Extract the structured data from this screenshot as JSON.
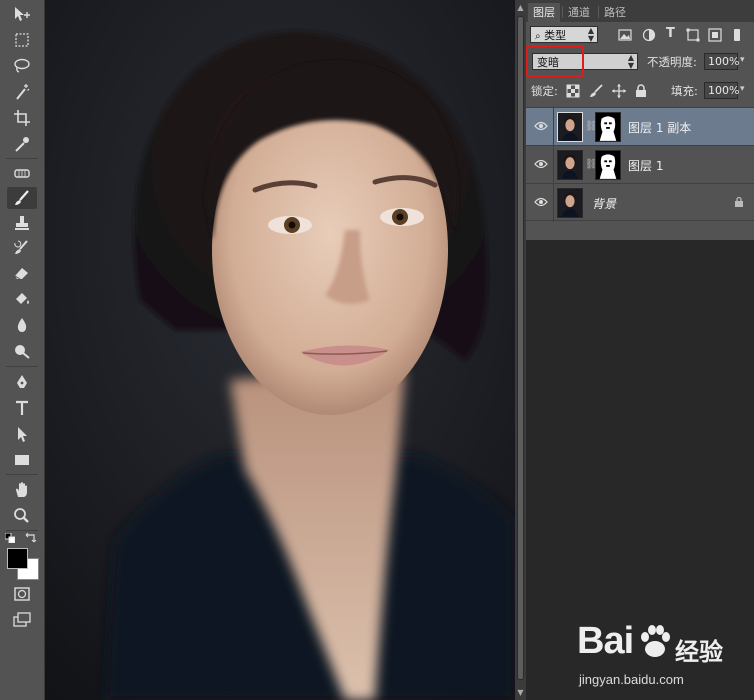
{
  "panel": {
    "tabs": [
      {
        "label": "图层",
        "active": true
      },
      {
        "label": "通道",
        "active": false
      },
      {
        "label": "路径",
        "active": false
      }
    ],
    "filter_kind": "类型",
    "blend_mode": "变暗",
    "opacity_label": "不透明度:",
    "opacity_value": "100%",
    "lock_label": "锁定:",
    "fill_label": "填充:",
    "fill_value": "100%",
    "layers": [
      {
        "name": "图层 1 副本",
        "selected": true,
        "has_mask": true,
        "visible": true
      },
      {
        "name": "图层 1",
        "selected": false,
        "has_mask": true,
        "visible": true
      },
      {
        "name": "背景",
        "selected": false,
        "has_mask": false,
        "locked": true,
        "visible": true
      }
    ],
    "highlight_color": "#e01b1b",
    "selected_layer_color": "#6d7b8f"
  },
  "toolbar": {
    "tools": [
      "move-icon",
      "marquee-icon",
      "lasso-icon",
      "magic-wand-icon",
      "crop-icon",
      "eyedropper-icon",
      "healing-brush-icon",
      "brush-icon",
      "clone-stamp-icon",
      "history-brush-icon",
      "eraser-icon",
      "paint-bucket-icon",
      "blur-icon",
      "dodge-icon",
      "pen-icon",
      "type-icon",
      "path-selection-icon",
      "rectangle-icon",
      "hand-icon",
      "zoom-icon"
    ],
    "active_tool": "brush-icon",
    "foreground_color": "#000000",
    "background_color": "#ffffff"
  },
  "watermark": {
    "brand": "Bai",
    "brand_cn": "经验",
    "url": "jingyan.baidu.com"
  }
}
